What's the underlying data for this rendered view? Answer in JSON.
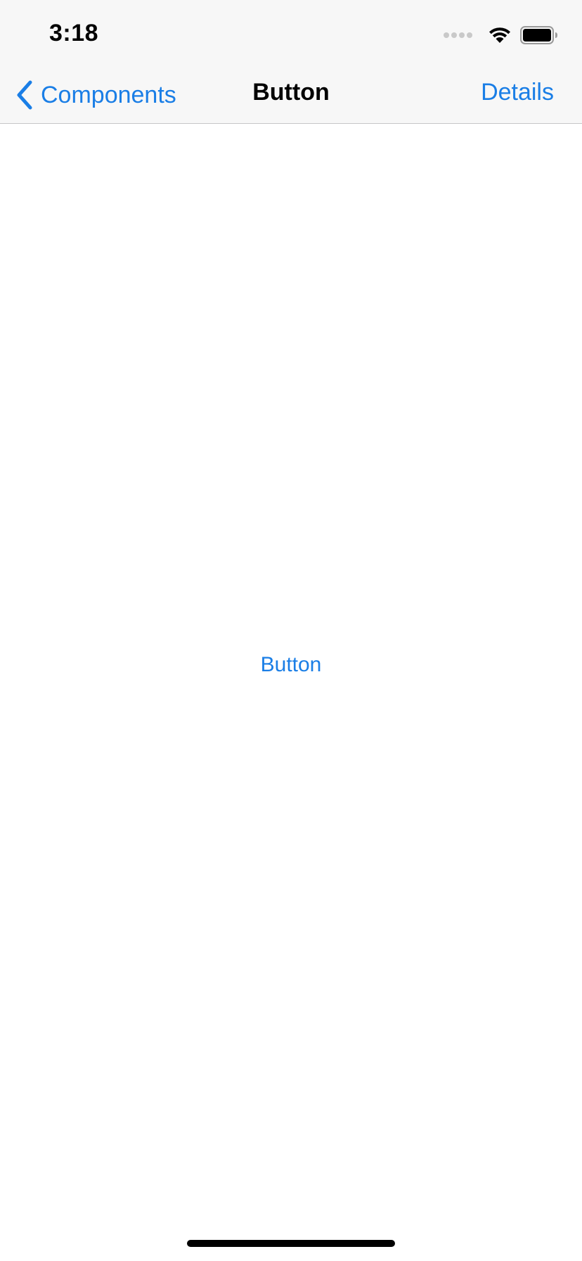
{
  "status_bar": {
    "time": "3:18",
    "icons": [
      "signal-dots-icon",
      "wifi-icon",
      "battery-icon"
    ]
  },
  "nav": {
    "back_label": "Components",
    "back_icon": "chevron-left-icon",
    "title": "Button",
    "action_label": "Details"
  },
  "content": {
    "button_label": "Button"
  },
  "colors": {
    "accent": "#1a7ee6",
    "text": "#000000",
    "background": "#ffffff",
    "bar_background": "#f7f7f7",
    "separator": "#c6c6c8"
  }
}
